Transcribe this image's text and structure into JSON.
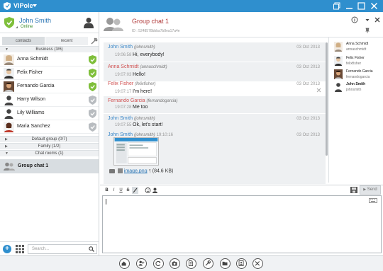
{
  "window": {
    "app_name": "VIPole"
  },
  "profile": {
    "name": "John Smith",
    "status": "Online"
  },
  "tabs": {
    "contacts": "contacts",
    "recent": "recent"
  },
  "groups": {
    "business": "Business (3/6)",
    "default": "Default group (0/7)",
    "family": "Family (1/2)",
    "chatrooms": "Chat rooms (1)"
  },
  "contacts": [
    {
      "name": "Anna Schmidt",
      "verified": true
    },
    {
      "name": "Felix Fisher",
      "verified": true
    },
    {
      "name": "Fernando Garcia",
      "verified": true
    },
    {
      "name": "Harry Wilson",
      "verified": false
    },
    {
      "name": "Lily Williams",
      "verified": false
    },
    {
      "name": "Maria Sanchez",
      "verified": false
    }
  ],
  "chatroom": {
    "name": "Group chat 1"
  },
  "search": {
    "placeholder": "Search..."
  },
  "chat": {
    "title": "Group chat 1",
    "id_text": "ID : 5248578bbba7b8ea17a4e"
  },
  "messages": [
    {
      "sender": "John Smith",
      "nick": "(johnsmith)",
      "date": "03 Oct 2013",
      "time": "19:06:58",
      "text": "Hi, everybody!",
      "color": "#3a87c8"
    },
    {
      "sender": "Anna Schmidt",
      "nick": "(annaschmidt)",
      "date": "03 Oct 2013",
      "time": "19:07:03",
      "text": "Hello!",
      "color": "#d05050"
    },
    {
      "sender": "Felix Fisher",
      "nick": "(felixfisher)",
      "date": "03 Oct 2013",
      "time": "19:07:17",
      "text": "I'm here!",
      "color": "#d05050"
    },
    {
      "sender": "Fernando Garcia",
      "nick": "(fernandogarcia)",
      "date": "",
      "time": "19:07:28",
      "text": "Me too",
      "color": "#d05050"
    },
    {
      "sender": "John Smith",
      "nick": "(johnsmith)",
      "date": "03 Oct 2013",
      "time": "19:07:55",
      "text": "Ok, let's start!",
      "color": "#3a87c8"
    },
    {
      "sender": "John Smith",
      "nick": "(johnsmith)",
      "date": "03 Oct 2013",
      "time": "19:10:16",
      "text": "",
      "color": "#3a87c8"
    }
  ],
  "attachment": {
    "filename": "image.png",
    "size": "(84.6 KB)"
  },
  "members": [
    {
      "name": "Anna Schmidt",
      "nick": "annaschmidt"
    },
    {
      "name": "Felix Fisher",
      "nick": "felixfisher"
    },
    {
      "name": "Fernando Garcia",
      "nick": "fernandogarcia"
    },
    {
      "name": "John Smith",
      "nick": "johnsmith"
    }
  ],
  "editor": {
    "format_buttons": [
      "B",
      "I",
      "U",
      "S"
    ],
    "send_label": "Send"
  },
  "colors": {
    "accent": "#2f8fce",
    "verified": "#7fbf3b",
    "unverified": "#b8bcc0"
  }
}
